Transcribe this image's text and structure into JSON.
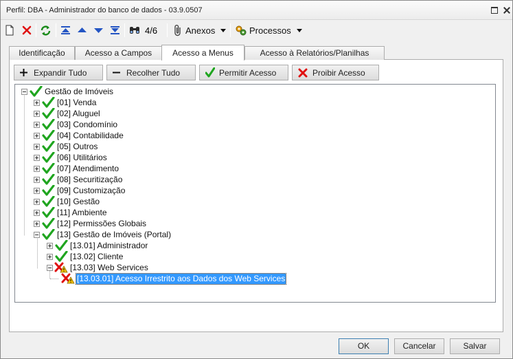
{
  "window": {
    "title": "Perfil: DBA - Administrador do banco de dados - 03.9.0507"
  },
  "toolbar": {
    "record_position": "4/6",
    "anexos_label": "Anexos",
    "processos_label": "Processos"
  },
  "tabs": [
    {
      "label": "Identificação",
      "active": false
    },
    {
      "label": "Acesso a Campos",
      "active": false
    },
    {
      "label": "Acesso a Menus",
      "active": true
    },
    {
      "label": "Acesso à Relatórios/Planilhas",
      "active": false
    }
  ],
  "actions": {
    "expandir": "Expandir Tudo",
    "recolher": "Recolher Tudo",
    "permitir": "Permitir Acesso",
    "proibir": "Proibir Acesso"
  },
  "tree": {
    "root": {
      "label": "Gestão de Imóveis",
      "status": "allowed"
    },
    "items": [
      {
        "label": "[01] Venda",
        "status": "allowed"
      },
      {
        "label": "[02] Aluguel",
        "status": "allowed"
      },
      {
        "label": "[03] Condomínio",
        "status": "allowed"
      },
      {
        "label": "[04] Contabilidade",
        "status": "allowed"
      },
      {
        "label": "[05] Outros",
        "status": "allowed"
      },
      {
        "label": "[06] Utilitários",
        "status": "allowed"
      },
      {
        "label": "[07] Atendimento",
        "status": "allowed"
      },
      {
        "label": "[08] Securitização",
        "status": "allowed"
      },
      {
        "label": "[09] Customização",
        "status": "allowed"
      },
      {
        "label": "[10] Gestão",
        "status": "allowed"
      },
      {
        "label": "[11] Ambiente",
        "status": "allowed"
      },
      {
        "label": "[12] Permissões Globais",
        "status": "allowed"
      },
      {
        "label": "[13] Gestão de Imóveis (Portal)",
        "status": "allowed"
      }
    ],
    "portal_children": [
      {
        "label": "[13.01] Administrador",
        "status": "allowed"
      },
      {
        "label": "[13.02] Cliente",
        "status": "allowed"
      },
      {
        "label": "[13.03] Web Services",
        "status": "denied-warning"
      }
    ],
    "leaf": {
      "label": "[13.03.01] Acesso Irrestrito aos Dados dos Web Services",
      "status": "denied-warning",
      "selected": true
    }
  },
  "footer": {
    "ok": "OK",
    "cancelar": "Cancelar",
    "salvar": "Salvar"
  },
  "colors": {
    "allowed": "#1fa51f",
    "denied": "#e01010",
    "warning": "#f5c400",
    "selection": "#3399ff"
  }
}
